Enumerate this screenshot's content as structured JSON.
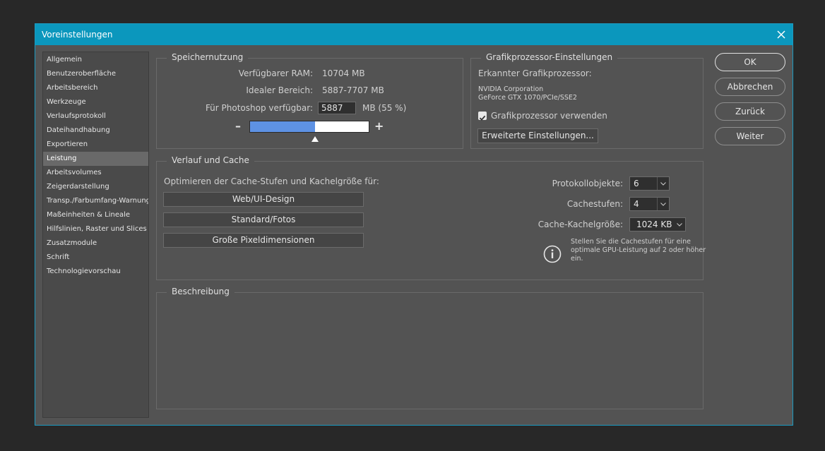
{
  "window": {
    "title": "Voreinstellungen"
  },
  "sidebar": {
    "items": [
      {
        "label": "Allgemein"
      },
      {
        "label": "Benutzeroberfläche"
      },
      {
        "label": "Arbeitsbereich"
      },
      {
        "label": "Werkzeuge"
      },
      {
        "label": "Verlaufsprotokoll"
      },
      {
        "label": "Dateihandhabung"
      },
      {
        "label": "Exportieren"
      },
      {
        "label": "Leistung"
      },
      {
        "label": "Arbeitsvolumes"
      },
      {
        "label": "Zeigerdarstellung"
      },
      {
        "label": "Transp./Farbumfang-Warnung"
      },
      {
        "label": "Maßeinheiten & Lineale"
      },
      {
        "label": "Hilfslinien, Raster und Slices"
      },
      {
        "label": "Zusatzmodule"
      },
      {
        "label": "Schrift"
      },
      {
        "label": "Technologievorschau"
      }
    ],
    "active_index": 7
  },
  "memory": {
    "title": "Speichernutzung",
    "available_label": "Verfügbarer RAM:",
    "available_value": "10704 MB",
    "ideal_label": "Idealer Bereich:",
    "ideal_value": "5887-7707 MB",
    "photoshop_label": "Für Photoshop verfügbar:",
    "photoshop_value": "5887",
    "photoshop_unit": "MB (55 %)",
    "minus": "–",
    "plus": "+",
    "slider_fraction": 0.55
  },
  "gpu": {
    "title": "Grafikprozessor-Einstellungen",
    "detected_label": "Erkannter Grafikprozessor:",
    "vendor": "NVIDIA Corporation",
    "model": "GeForce GTX 1070/PCIe/SSE2",
    "use_gpu_label": "Grafikprozessor verwenden",
    "use_gpu_checked": true,
    "advanced_button": "Erweiterte Einstellungen..."
  },
  "cache": {
    "title": "Verlauf und Cache",
    "optimize_label": "Optimieren der Cache-Stufen und Kachelgröße für:",
    "buttons": {
      "web": "Web/UI-Design",
      "standard": "Standard/Fotos",
      "large": "Große Pixeldimensionen"
    },
    "history_label": "Protokollobjekte:",
    "history_value": "6",
    "levels_label": "Cachestufen:",
    "levels_value": "4",
    "tile_label": "Cache-Kachelgröße:",
    "tile_value": "1024 KB",
    "info_text": "Stellen Sie die Cachestufen für eine optimale GPU-Leistung auf 2 oder höher ein."
  },
  "description": {
    "title": "Beschreibung"
  },
  "actions": {
    "ok": "OK",
    "cancel": "Abbrechen",
    "back": "Zurück",
    "next": "Weiter"
  },
  "colors": {
    "titlebar": "#0b97bd",
    "slider_fill": "#5e92e4",
    "dialog_bg": "#535353"
  }
}
